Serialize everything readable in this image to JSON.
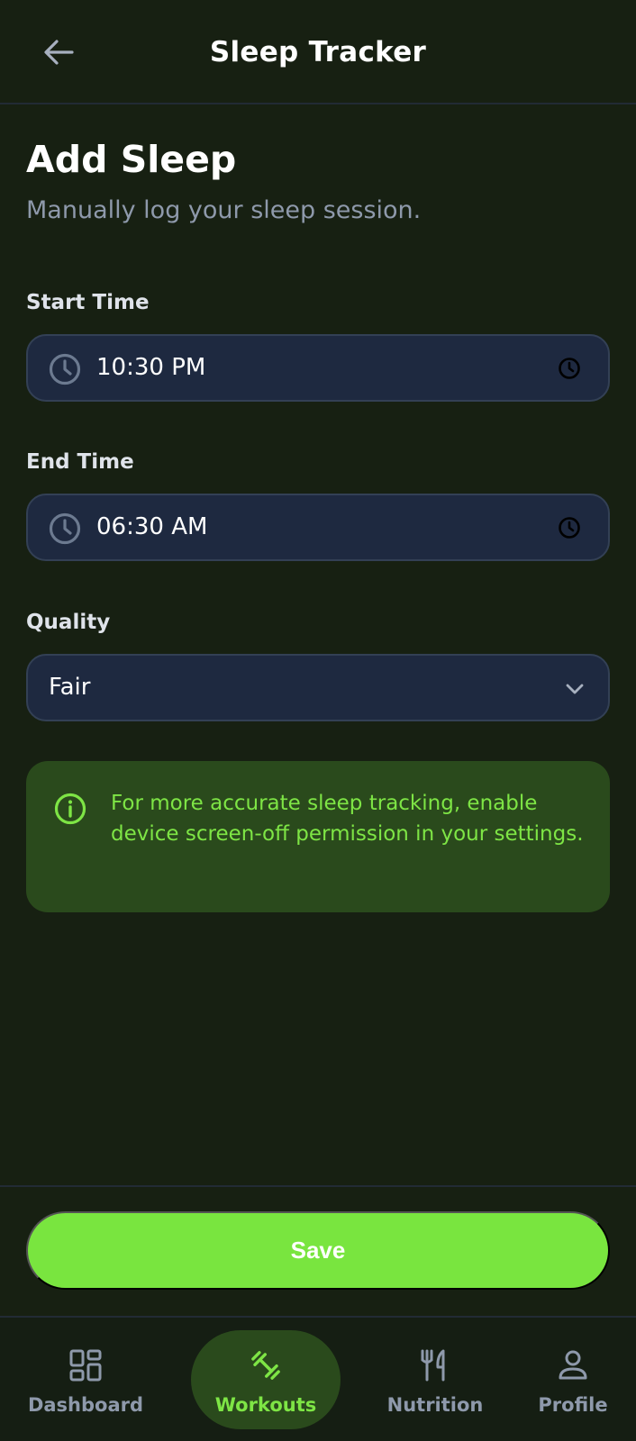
{
  "header": {
    "title": "Sleep Tracker",
    "back_icon": "arrow-left-icon"
  },
  "page": {
    "title": "Add Sleep",
    "subtitle": "Manually log your sleep session."
  },
  "form": {
    "start_time": {
      "label": "Start Time",
      "value": "10:30 PM",
      "icon": "clock-icon"
    },
    "end_time": {
      "label": "End Time",
      "value": "06:30 AM",
      "icon": "clock-icon"
    },
    "quality": {
      "label": "Quality",
      "value": "Fair",
      "icon": "chevron-down-icon"
    }
  },
  "notice": {
    "icon": "info-icon",
    "text": "For more accurate sleep tracking, enable device screen-off permission in your settings."
  },
  "actions": {
    "save_label": "Save"
  },
  "bottom_nav": {
    "items": [
      {
        "label": "Dashboard",
        "icon": "dashboard-icon",
        "active": false
      },
      {
        "label": "Workouts",
        "icon": "dumbbell-icon",
        "active": true
      },
      {
        "label": "Nutrition",
        "icon": "fork-knife-icon",
        "active": false
      },
      {
        "label": "Profile",
        "icon": "person-icon",
        "active": false
      }
    ]
  },
  "colors": {
    "background": "#172012",
    "accent": "#79e53f",
    "field_background": "#1e2940",
    "notice_background": "#2a4a1c",
    "muted_text": "#8e99ab"
  }
}
